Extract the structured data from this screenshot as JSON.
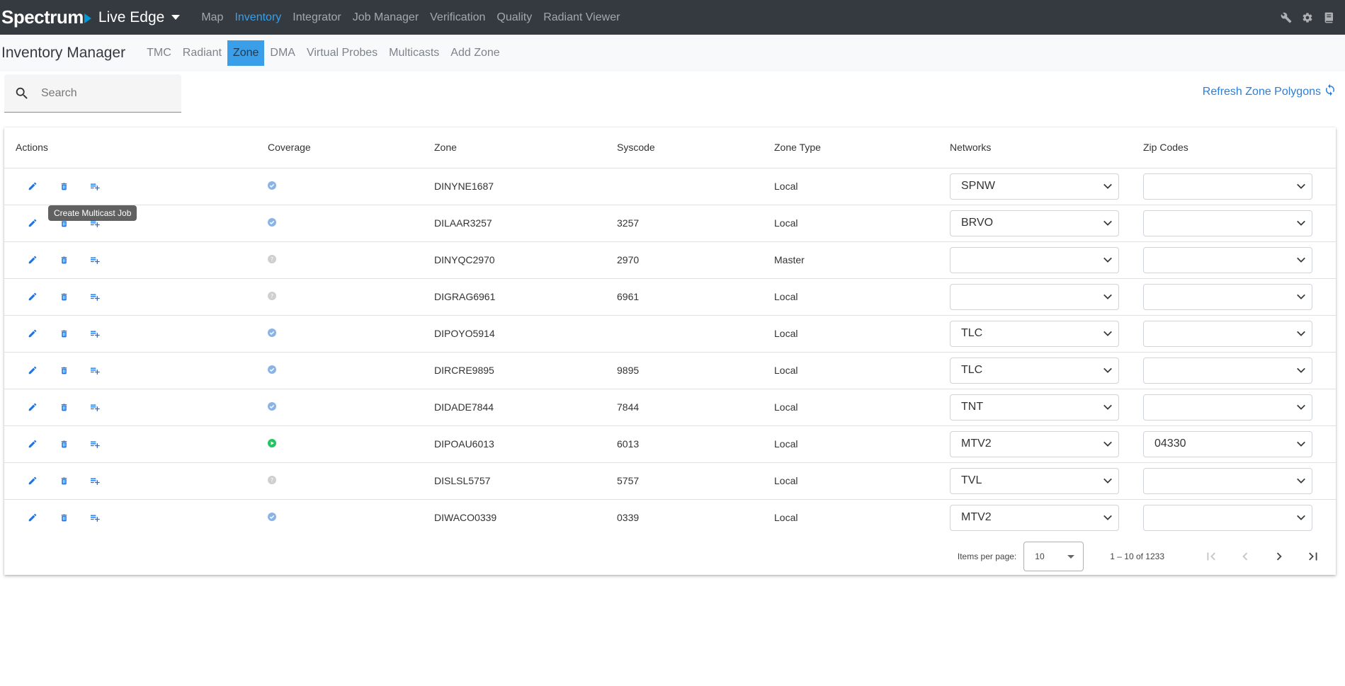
{
  "app": {
    "brand": "Spectrum",
    "product": "Live Edge",
    "nav": [
      "Map",
      "Inventory",
      "Integrator",
      "Job Manager",
      "Verification",
      "Quality",
      "Radiant Viewer"
    ],
    "active_nav": "Inventory",
    "top_icons": [
      "wrench-icon",
      "gear-icon",
      "book-icon"
    ]
  },
  "subnav": {
    "title": "Inventory Manager",
    "tabs": [
      "TMC",
      "Radiant",
      "Zone",
      "DMA",
      "Virtual Probes",
      "Multicasts",
      "Add Zone"
    ],
    "active_tab": "Zone"
  },
  "search": {
    "placeholder": "Search",
    "value": ""
  },
  "refresh": {
    "label": "Refresh Zone Polygons"
  },
  "table": {
    "headers": {
      "actions": "Actions",
      "coverage": "Coverage",
      "zone": "Zone",
      "syscode": "Syscode",
      "zone_type": "Zone Type",
      "networks": "Networks",
      "zip_codes": "Zip Codes"
    },
    "rows": [
      {
        "coverage": "verified",
        "zone": "DINYNE1687",
        "syscode": "",
        "zone_type": "Local",
        "network": "SPNW",
        "zip": ""
      },
      {
        "coverage": "verified",
        "zone": "DILAAR3257",
        "syscode": "3257",
        "zone_type": "Local",
        "network": "BRVO",
        "zip": ""
      },
      {
        "coverage": "unknown",
        "zone": "DINYQC2970",
        "syscode": "2970",
        "zone_type": "Master",
        "network": "",
        "zip": ""
      },
      {
        "coverage": "unknown",
        "zone": "DIGRAG6961",
        "syscode": "6961",
        "zone_type": "Local",
        "network": "",
        "zip": ""
      },
      {
        "coverage": "verified",
        "zone": "DIPOYO5914",
        "syscode": "",
        "zone_type": "Local",
        "network": "TLC",
        "zip": ""
      },
      {
        "coverage": "verified",
        "zone": "DIRCRE9895",
        "syscode": "9895",
        "zone_type": "Local",
        "network": "TLC",
        "zip": ""
      },
      {
        "coverage": "verified",
        "zone": "DIDADE7844",
        "syscode": "7844",
        "zone_type": "Local",
        "network": "TNT",
        "zip": ""
      },
      {
        "coverage": "active",
        "zone": "DIPOAU6013",
        "syscode": "6013",
        "zone_type": "Local",
        "network": "MTV2",
        "zip": "04330"
      },
      {
        "coverage": "unknown",
        "zone": "DISLSL5757",
        "syscode": "5757",
        "zone_type": "Local",
        "network": "TVL",
        "zip": ""
      },
      {
        "coverage": "verified",
        "zone": "DIWACO0339",
        "syscode": "0339",
        "zone_type": "Local",
        "network": "MTV2",
        "zip": ""
      }
    ]
  },
  "tooltip": {
    "text": "Create Multicast Job"
  },
  "paginator": {
    "items_per_page_label": "Items per page:",
    "items_per_page": "10",
    "range": "1 – 10 of 1233"
  },
  "colors": {
    "navbar": "#343a40",
    "accent": "#3a9ee8",
    "action_blue": "#1a73e8",
    "coverage_verified": "#8ab4e8",
    "coverage_unknown": "#cfcfcf",
    "coverage_active": "#22c55e"
  }
}
